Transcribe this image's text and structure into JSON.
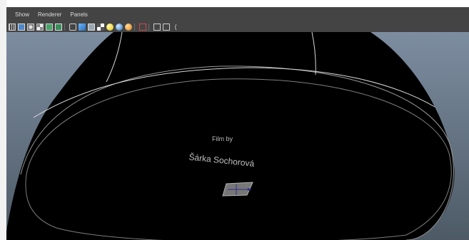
{
  "menubar": {
    "items": [
      "Show",
      "Renderer",
      "Panels"
    ]
  },
  "toolbar": {
    "icons": [
      "grid-icon",
      "wireframe-icon",
      "smooth-shade-icon",
      "texture-icon",
      "lighting-icon",
      "shadow-icon",
      "camera-icon",
      "isolate-icon",
      "cube-icon",
      "cylinder-icon",
      "sphere-icon",
      "light-yellow-icon",
      "light-blue-icon",
      "light-orange-icon",
      "select-icon",
      "camera-view-icon",
      "frame-icon",
      "share-icon"
    ]
  },
  "viewport": {
    "background_color": "#6b7a89",
    "title_line1": "Film by",
    "title_line2": "Šárka Sochorová"
  },
  "colors": {
    "menubar_bg": "#444444",
    "menu_text": "#dcdcdc",
    "viewport_bg": "#6b7a89",
    "object_fill": "#000000",
    "wire_color": "#cfcfcf"
  }
}
